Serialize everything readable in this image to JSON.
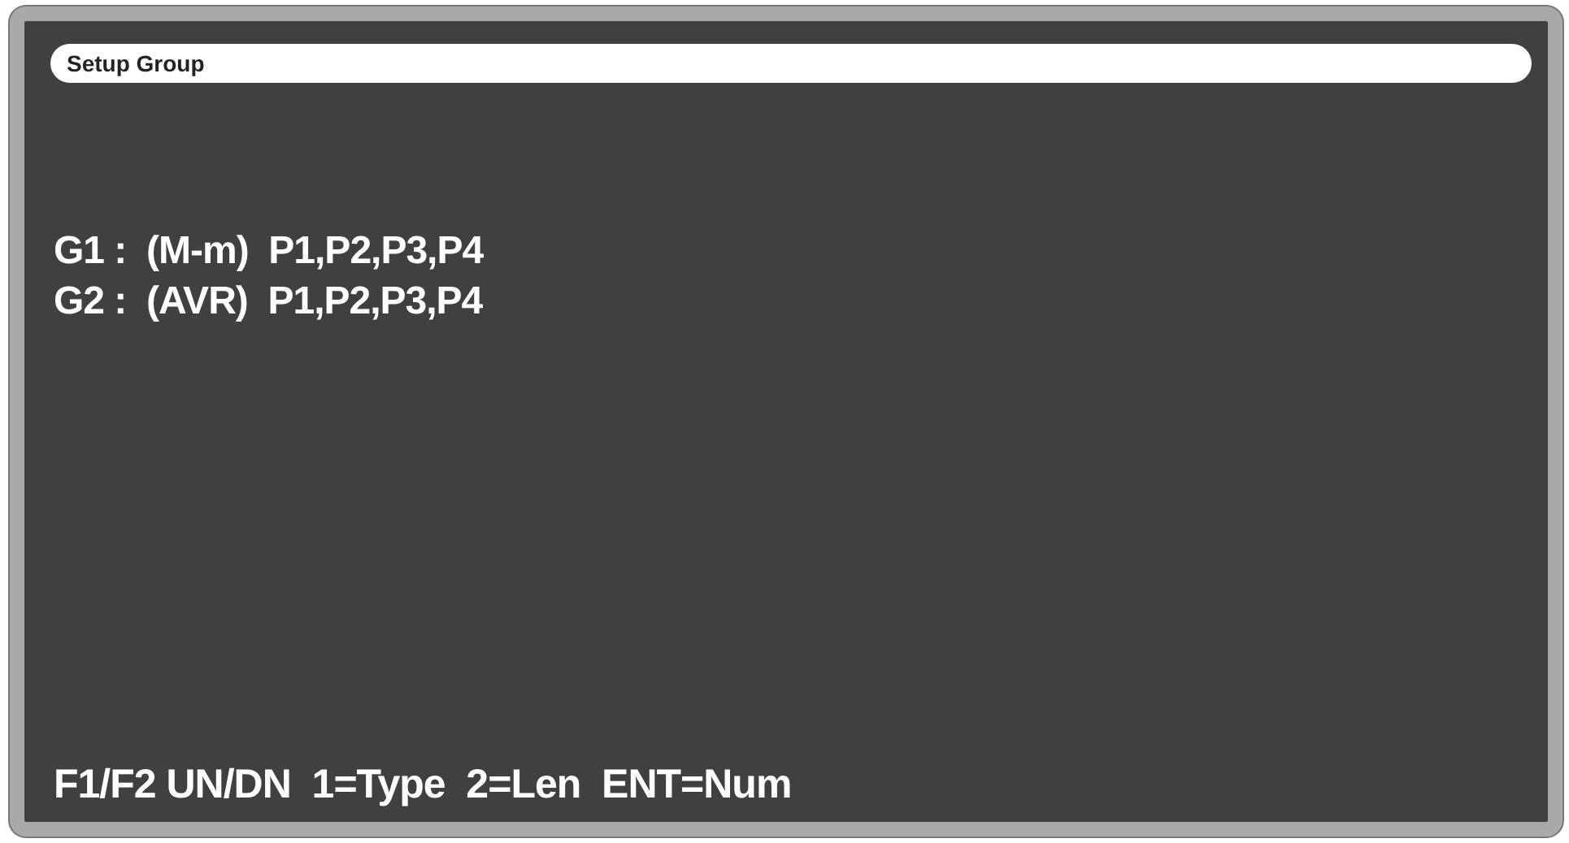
{
  "title": "Setup Group",
  "lines": [
    "G1 :  (M-m)  P1,P2,P3,P4",
    "G2 :  (AVR)  P1,P2,P3,P4"
  ],
  "footer": "F1/F2 UN/DN  1=Type  2=Len  ENT=Num"
}
